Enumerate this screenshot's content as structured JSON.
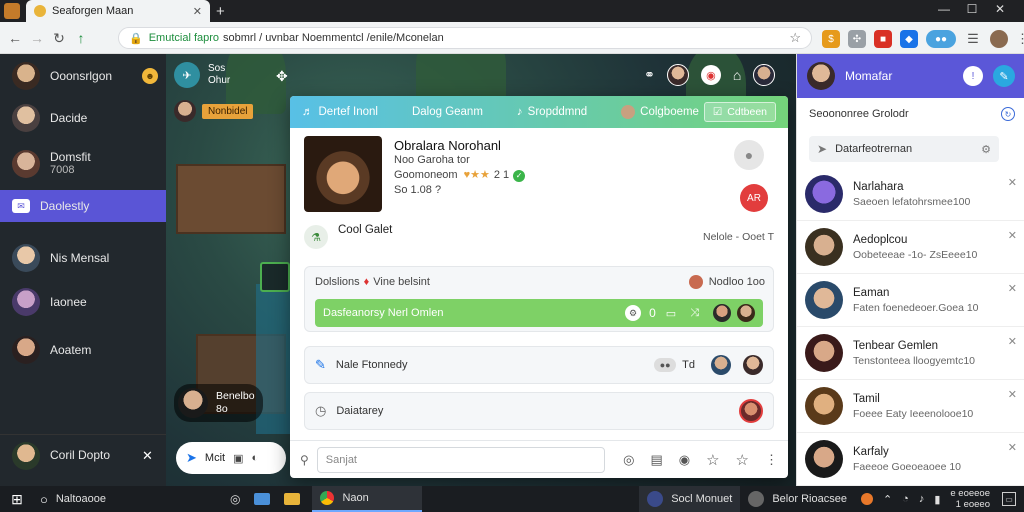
{
  "browser": {
    "tab_title": "Seaforgen Maan",
    "url_secure": "Emutcial fapro",
    "url_path": "sobmrl / uvnbar Noemmentcl /enile/Mconelan"
  },
  "left_sidebar": {
    "items": [
      {
        "label": "Ooonsrlgon",
        "sub": ""
      },
      {
        "label": "Dacide",
        "sub": ""
      },
      {
        "label": "Domsfit",
        "sub": "7008"
      },
      {
        "label": "Daolestly",
        "sub": ""
      },
      {
        "label": "Nis Mensal",
        "sub": ""
      },
      {
        "label": "Iaonee",
        "sub": ""
      },
      {
        "label": "Aoatem",
        "sub": ""
      }
    ],
    "bottom_label": "Coril Dopto"
  },
  "game": {
    "top_user": {
      "line1": "Sos",
      "line2": "Ohur"
    },
    "banner": "Nonbidel",
    "chat_user": {
      "line1": "Benelbo",
      "line2": "8o"
    },
    "chat_input": "Mcit"
  },
  "modal": {
    "tabs": [
      "Dertef Inonl",
      "Dalog Geanm",
      "Sropddmnd",
      "Colgboeme",
      "Cdtbeen"
    ],
    "profile": {
      "name": "Obralara Norohanl",
      "line2": "Noo Garoha tor",
      "line3": "Goomoneom",
      "rating": "2 1",
      "line4": "So 1.08 ?",
      "action_badge": "AR"
    },
    "section_title": "Cool Galet",
    "section_meta": "Nelole - Ooet T",
    "card1": {
      "title": "Dolslions",
      "title2": "Vine belsint",
      "right": "Nodloo 1oo",
      "bar_label": "Dasfeanorsy Nerl Omlen",
      "bar_count": "0"
    },
    "card2": {
      "title": "Nale Ftonnedy",
      "meta": "Td"
    },
    "card3": {
      "title": "Daiatarey"
    },
    "input_placeholder": "Sanjat"
  },
  "right_panel": {
    "title": "Momafar",
    "subtitle": "Seoononree Grolodr",
    "search": "Datarfeotrernan",
    "items": [
      {
        "name": "Narlahara",
        "sub": "Saeoen lefatohrsmee100"
      },
      {
        "name": "Aedoplcou",
        "sub": "Oobeteeae -1o- ZsEeee10"
      },
      {
        "name": "Eaman",
        "sub": "Faten foenedeoer.Goea 10"
      },
      {
        "name": "Tenbear Gemlen",
        "sub": "Tenstonteea lloogyemtc10"
      },
      {
        "name": "Tamil",
        "sub": "Foeee Eaty Ieeenolooe10"
      },
      {
        "name": "Karfaly",
        "sub": "Faeeoe Goeoeaoee 10"
      }
    ]
  },
  "taskbar": {
    "search": "Naltoaooe",
    "app_label": "Naon",
    "tray1": "Socl Monuet",
    "tray2": "Belor Rioacsee",
    "clock_line1": "e eoeeoe",
    "clock_line2": "1 eoeeo"
  },
  "colors": {
    "accent": "#5b57d8",
    "modal_gradient_start": "#58c0e6",
    "modal_gradient_end": "#74d37a",
    "green_bar": "#7ed166",
    "notify_red": "#e23d3d"
  }
}
